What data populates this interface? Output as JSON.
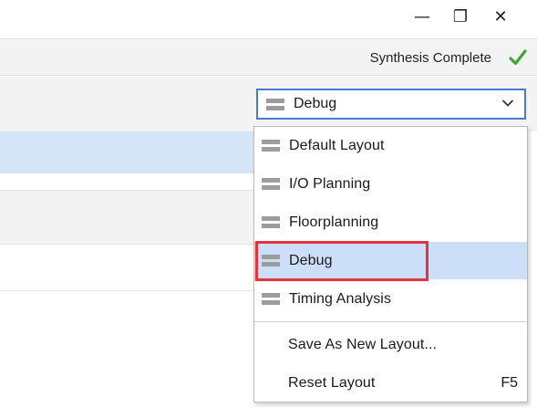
{
  "window_controls": {
    "minimize": "—",
    "maximize": "❐",
    "close": "✕"
  },
  "status": {
    "text": "Synthesis Complete",
    "icon": "check-icon",
    "icon_color": "#3ea535"
  },
  "layout_selector": {
    "selected": "Debug",
    "icon": "layout-icon",
    "border_color": "#4a7bd0"
  },
  "menu": {
    "items": [
      {
        "label": "Default Layout",
        "icon": "layout-icon"
      },
      {
        "label": "I/O Planning",
        "icon": "layout-icon"
      },
      {
        "label": "Floorplanning",
        "icon": "layout-icon"
      },
      {
        "label": "Debug",
        "icon": "layout-icon",
        "selected": true
      },
      {
        "label": "Timing Analysis",
        "icon": "layout-icon"
      }
    ],
    "actions": [
      {
        "label": "Save As New Layout..."
      },
      {
        "label": "Reset Layout",
        "shortcut": "F5"
      }
    ],
    "selected_bg": "#cddff8",
    "highlight_color": "#e4333a"
  }
}
